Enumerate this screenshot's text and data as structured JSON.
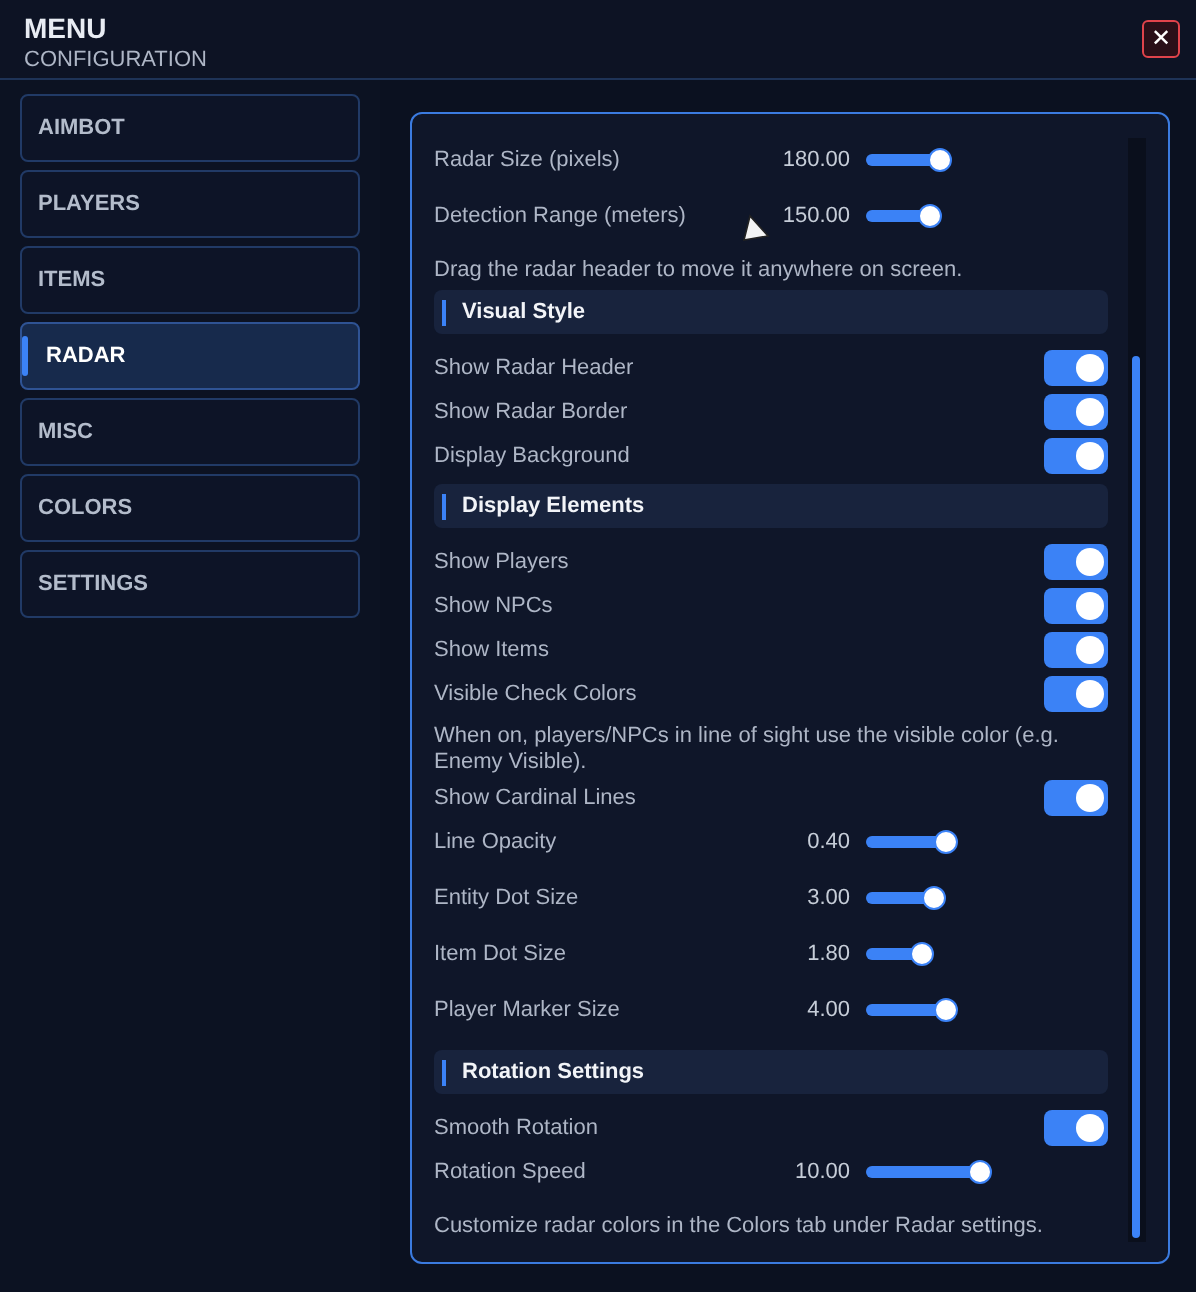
{
  "header": {
    "title": "MENU",
    "subtitle": "CONFIGURATION",
    "close": "✕"
  },
  "sidebar": {
    "items": [
      {
        "label": "AIMBOT",
        "selected": false
      },
      {
        "label": "PLAYERS",
        "selected": false
      },
      {
        "label": "ITEMS",
        "selected": false
      },
      {
        "label": "RADAR",
        "selected": true
      },
      {
        "label": "MISC",
        "selected": false
      },
      {
        "label": "COLORS",
        "selected": false
      },
      {
        "label": "SETTINGS",
        "selected": false
      }
    ]
  },
  "settings": [
    {
      "kind": "slider",
      "label": "Radar Size (pixels)",
      "value": "180.00",
      "level": 0.37
    },
    {
      "kind": "slider",
      "label": "Detection Range (meters)",
      "value": "150.00",
      "level": 0.32
    },
    {
      "kind": "note",
      "text": "Drag the radar header to move it anywhere on screen."
    },
    {
      "kind": "section",
      "label": "Visual Style"
    },
    {
      "kind": "toggle",
      "label": "Show Radar Header",
      "on": true
    },
    {
      "kind": "toggle",
      "label": "Show Radar Border",
      "on": true
    },
    {
      "kind": "toggle",
      "label": "Display Background",
      "on": true
    },
    {
      "kind": "section",
      "label": "Display Elements"
    },
    {
      "kind": "toggle",
      "label": "Show Players",
      "on": true
    },
    {
      "kind": "toggle",
      "label": "Show NPCs",
      "on": true
    },
    {
      "kind": "toggle",
      "label": "Show Items",
      "on": true
    },
    {
      "kind": "toggle",
      "label": "Visible Check Colors",
      "on": true
    },
    {
      "kind": "note",
      "text": "When on, players/NPCs in line of sight use the visible color (e.g. Enemy Visible)."
    },
    {
      "kind": "toggle",
      "label": "Show Cardinal Lines",
      "on": true
    },
    {
      "kind": "slider",
      "label": "Line Opacity",
      "value": "0.40",
      "level": 0.4
    },
    {
      "kind": "slider",
      "label": "Entity Dot Size",
      "value": "3.00",
      "level": 0.34
    },
    {
      "kind": "slider",
      "label": "Item Dot Size",
      "value": "1.80",
      "level": 0.28
    },
    {
      "kind": "slider",
      "label": "Player Marker Size",
      "value": "4.00",
      "level": 0.4
    },
    {
      "kind": "section",
      "label": "Rotation Settings"
    },
    {
      "kind": "toggle",
      "label": "Smooth Rotation",
      "on": true
    },
    {
      "kind": "slider",
      "label": "Rotation Speed",
      "value": "10.00",
      "level": 0.57
    },
    {
      "kind": "note",
      "text": "Customize radar colors in the Colors tab under Radar settings."
    }
  ]
}
